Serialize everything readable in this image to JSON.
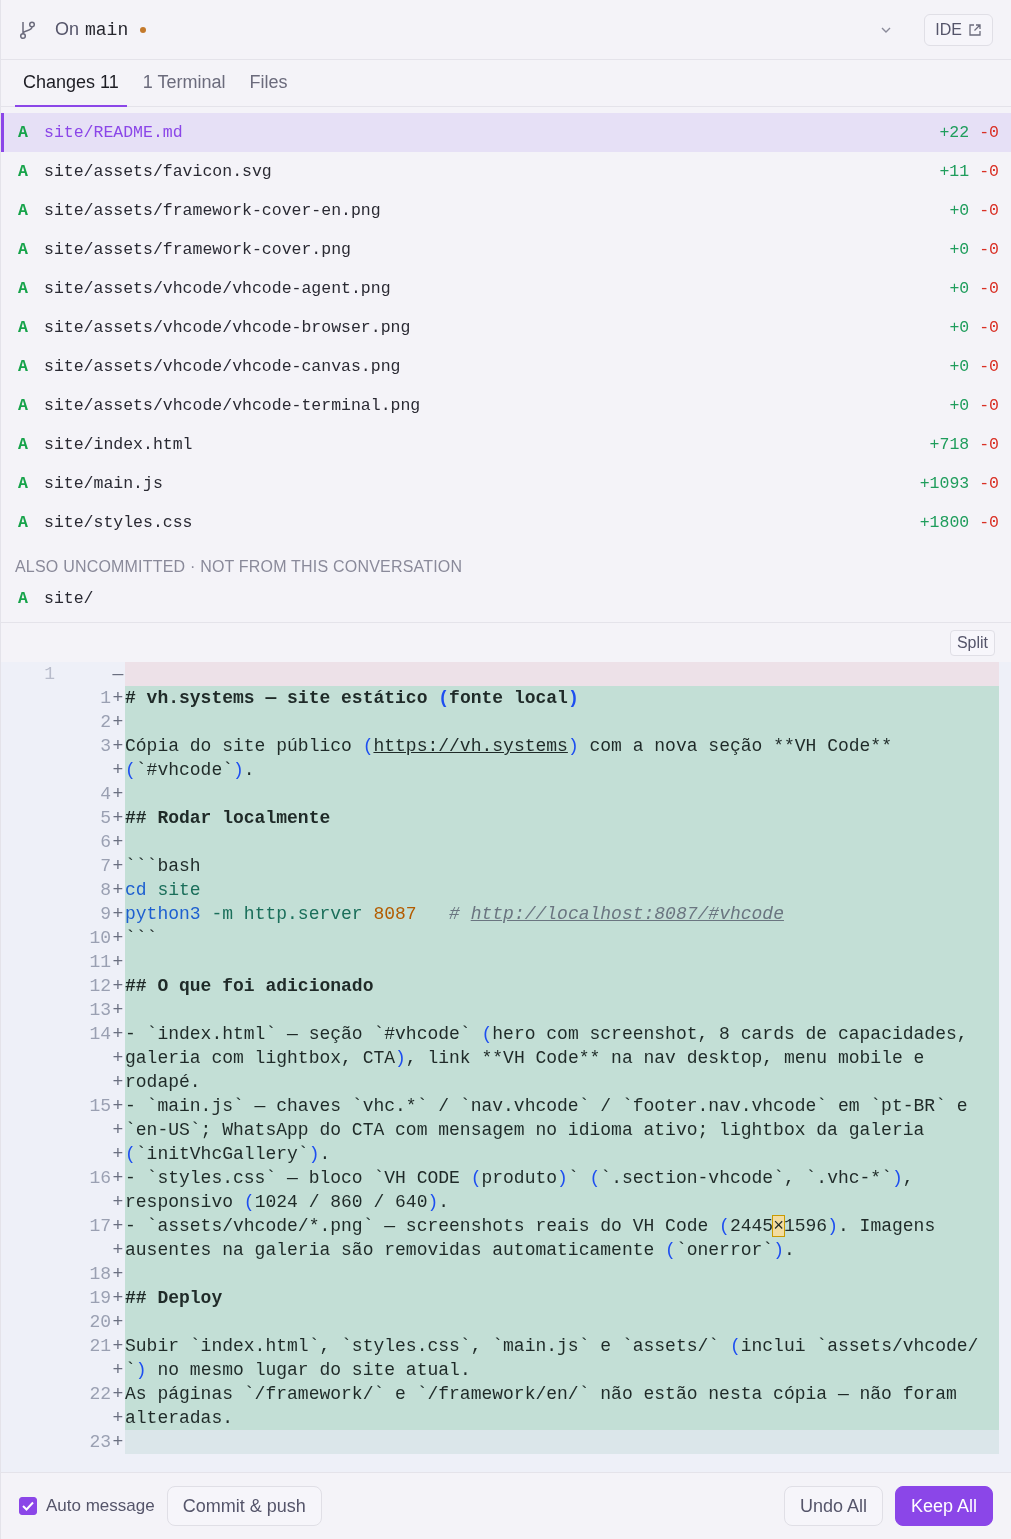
{
  "branch": {
    "prefix": "On",
    "name": "main",
    "dirty": true
  },
  "ide_button": "IDE",
  "tabs": [
    {
      "label": "Changes 11",
      "selected": true
    },
    {
      "label": "1 Terminal",
      "selected": false
    },
    {
      "label": "Files",
      "selected": false
    }
  ],
  "files": [
    {
      "status": "A",
      "path": "site/README.md",
      "added": "+22",
      "removed": "-0",
      "selected": true
    },
    {
      "status": "A",
      "path": "site/assets/favicon.svg",
      "added": "+11",
      "removed": "-0",
      "selected": false
    },
    {
      "status": "A",
      "path": "site/assets/framework-cover-en.png",
      "added": "+0",
      "removed": "-0",
      "selected": false
    },
    {
      "status": "A",
      "path": "site/assets/framework-cover.png",
      "added": "+0",
      "removed": "-0",
      "selected": false
    },
    {
      "status": "A",
      "path": "site/assets/vhcode/vhcode-agent.png",
      "added": "+0",
      "removed": "-0",
      "selected": false
    },
    {
      "status": "A",
      "path": "site/assets/vhcode/vhcode-browser.png",
      "added": "+0",
      "removed": "-0",
      "selected": false
    },
    {
      "status": "A",
      "path": "site/assets/vhcode/vhcode-canvas.png",
      "added": "+0",
      "removed": "-0",
      "selected": false
    },
    {
      "status": "A",
      "path": "site/assets/vhcode/vhcode-terminal.png",
      "added": "+0",
      "removed": "-0",
      "selected": false
    },
    {
      "status": "A",
      "path": "site/index.html",
      "added": "+718",
      "removed": "-0",
      "selected": false
    },
    {
      "status": "A",
      "path": "site/main.js",
      "added": "+1093",
      "removed": "-0",
      "selected": false
    },
    {
      "status": "A",
      "path": "site/styles.css",
      "added": "+1800",
      "removed": "-0",
      "selected": false
    }
  ],
  "other_section": {
    "title": "ALSO UNCOMMITTED · NOT FROM THIS CONVERSATION",
    "files": [
      {
        "status": "A",
        "path": "site/"
      }
    ]
  },
  "diff": {
    "view_button": "Split",
    "lines": [
      {
        "kind": "deleted",
        "old": "1",
        "marker": "—"
      },
      {
        "kind": "added",
        "new": "1",
        "marker": "+",
        "bold": true,
        "rows": [
          {
            "segments": [
              {
                "kind": "text",
                "text": "# vh.systems — site estático "
              },
              {
                "kind": "paren",
                "text": "("
              },
              {
                "kind": "text",
                "text": "fonte local"
              },
              {
                "kind": "paren",
                "text": ")"
              }
            ]
          }
        ]
      },
      {
        "kind": "added",
        "new": "2",
        "marker": "+"
      },
      {
        "kind": "added",
        "new": "3",
        "marker": "+",
        "rows": [
          {
            "segments": [
              {
                "kind": "text",
                "text": "Cópia do site público "
              },
              {
                "kind": "paren",
                "text": "("
              },
              {
                "kind": "url",
                "text": "https://vh.systems"
              },
              {
                "kind": "paren",
                "text": ")"
              },
              {
                "kind": "text",
                "text": " com a nova seção **VH Code**"
              }
            ]
          },
          {
            "segments": [
              {
                "kind": "paren",
                "text": "("
              },
              {
                "kind": "text",
                "text": "`#vhcode`"
              },
              {
                "kind": "paren",
                "text": ")"
              },
              {
                "kind": "text",
                "text": "."
              }
            ]
          }
        ]
      },
      {
        "kind": "added",
        "new": "4",
        "marker": "+"
      },
      {
        "kind": "added",
        "new": "5",
        "marker": "+",
        "bold": true,
        "rows": [
          {
            "segments": [
              {
                "kind": "text",
                "text": "## Rodar localmente"
              }
            ]
          }
        ]
      },
      {
        "kind": "added",
        "new": "6",
        "marker": "+"
      },
      {
        "kind": "added",
        "new": "7",
        "marker": "+",
        "rows": [
          {
            "segments": [
              {
                "kind": "text",
                "text": "```bash"
              }
            ]
          }
        ]
      },
      {
        "kind": "added",
        "new": "8",
        "marker": "+",
        "rows": [
          {
            "segments": [
              {
                "kind": "keyword",
                "text": "cd "
              },
              {
                "kind": "arg",
                "text": "site"
              }
            ]
          }
        ]
      },
      {
        "kind": "added",
        "new": "9",
        "marker": "+",
        "rows": [
          {
            "segments": [
              {
                "kind": "keyword",
                "text": "python3 "
              },
              {
                "kind": "arg",
                "text": "-m http.server "
              },
              {
                "kind": "number",
                "text": "8087"
              },
              {
                "kind": "comment",
                "text": "   # "
              },
              {
                "kind": "comment-url",
                "text": "http://localhost:8087/#vhcode"
              }
            ]
          }
        ]
      },
      {
        "kind": "added",
        "new": "10",
        "marker": "+",
        "rows": [
          {
            "segments": [
              {
                "kind": "text",
                "text": "```"
              }
            ]
          }
        ]
      },
      {
        "kind": "added",
        "new": "11",
        "marker": "+"
      },
      {
        "kind": "added",
        "new": "12",
        "marker": "+",
        "bold": true,
        "rows": [
          {
            "segments": [
              {
                "kind": "text",
                "text": "## O que foi adicionado"
              }
            ]
          }
        ]
      },
      {
        "kind": "added",
        "new": "13",
        "marker": "+"
      },
      {
        "kind": "added",
        "new": "14",
        "marker": "+",
        "rows": [
          {
            "segments": [
              {
                "kind": "text",
                "text": "- `index.html` — seção `#vhcode` "
              },
              {
                "kind": "paren",
                "text": "("
              },
              {
                "kind": "text",
                "text": "hero com screenshot, 8 cards de capacidades,"
              }
            ]
          },
          {
            "segments": [
              {
                "kind": "text",
                "text": "galeria com lightbox, CTA"
              },
              {
                "kind": "paren",
                "text": ")"
              },
              {
                "kind": "text",
                "text": ", link **VH Code** na nav desktop, menu mobile e"
              }
            ]
          },
          {
            "segments": [
              {
                "kind": "text",
                "text": "rodapé."
              }
            ]
          }
        ]
      },
      {
        "kind": "added",
        "new": "15",
        "marker": "+",
        "rows": [
          {
            "segments": [
              {
                "kind": "text",
                "text": "- `main.js` — chaves `vhc.*` / `nav.vhcode` / `footer.nav.vhcode` em `pt-BR` e"
              }
            ]
          },
          {
            "segments": [
              {
                "kind": "text",
                "text": "`en-US`; WhatsApp do CTA com mensagem no idioma ativo; lightbox da galeria"
              }
            ]
          },
          {
            "segments": [
              {
                "kind": "paren",
                "text": "("
              },
              {
                "kind": "text",
                "text": "`initVhcGallery`"
              },
              {
                "kind": "paren",
                "text": ")"
              },
              {
                "kind": "text",
                "text": "."
              }
            ]
          }
        ]
      },
      {
        "kind": "added",
        "new": "16",
        "marker": "+",
        "rows": [
          {
            "segments": [
              {
                "kind": "text",
                "text": "- `styles.css` — bloco `VH CODE "
              },
              {
                "kind": "paren",
                "text": "("
              },
              {
                "kind": "text",
                "text": "produto"
              },
              {
                "kind": "paren",
                "text": ")"
              },
              {
                "kind": "text",
                "text": "` "
              },
              {
                "kind": "paren",
                "text": "("
              },
              {
                "kind": "text",
                "text": "`.section-vhcode`, `.vhc-*`"
              },
              {
                "kind": "paren",
                "text": ")"
              },
              {
                "kind": "text",
                "text": ","
              }
            ]
          },
          {
            "segments": [
              {
                "kind": "text",
                "text": "responsivo "
              },
              {
                "kind": "paren",
                "text": "("
              },
              {
                "kind": "text",
                "text": "1024 / 860 / 640"
              },
              {
                "kind": "paren",
                "text": ")"
              },
              {
                "kind": "text",
                "text": "."
              }
            ]
          }
        ]
      },
      {
        "kind": "added",
        "new": "17",
        "marker": "+",
        "rows": [
          {
            "segments": [
              {
                "kind": "text",
                "text": "- `assets/vhcode/*.png` — screenshots reais do VH Code "
              },
              {
                "kind": "paren",
                "text": "("
              },
              {
                "kind": "text",
                "text": "2445"
              },
              {
                "kind": "match",
                "text": "×"
              },
              {
                "kind": "text",
                "text": "1596"
              },
              {
                "kind": "paren",
                "text": ")"
              },
              {
                "kind": "text",
                "text": ". Imagens"
              }
            ]
          },
          {
            "segments": [
              {
                "kind": "text",
                "text": "ausentes na galeria são removidas automaticamente "
              },
              {
                "kind": "paren",
                "text": "("
              },
              {
                "kind": "text",
                "text": "`onerror`"
              },
              {
                "kind": "paren",
                "text": ")"
              },
              {
                "kind": "text",
                "text": "."
              }
            ]
          }
        ]
      },
      {
        "kind": "added",
        "new": "18",
        "marker": "+"
      },
      {
        "kind": "added",
        "new": "19",
        "marker": "+",
        "bold": true,
        "rows": [
          {
            "segments": [
              {
                "kind": "text",
                "text": "## Deploy"
              }
            ]
          }
        ]
      },
      {
        "kind": "added",
        "new": "20",
        "marker": "+"
      },
      {
        "kind": "added",
        "new": "21",
        "marker": "+",
        "rows": [
          {
            "segments": [
              {
                "kind": "text",
                "text": "Subir `index.html`, `styles.css`, `main.js` e `assets/` "
              },
              {
                "kind": "paren",
                "text": "("
              },
              {
                "kind": "text",
                "text": "inclui `assets/vhcode/"
              }
            ]
          },
          {
            "segments": [
              {
                "kind": "text",
                "text": "`"
              },
              {
                "kind": "paren",
                "text": ")"
              },
              {
                "kind": "text",
                "text": " no mesmo lugar do site atual."
              }
            ]
          }
        ]
      },
      {
        "kind": "added",
        "new": "22",
        "marker": "+",
        "rows": [
          {
            "segments": [
              {
                "kind": "text",
                "text": "As páginas `/framework/` e `/framework/en/` não estão nesta cópia — não foram"
              }
            ]
          },
          {
            "segments": [
              {
                "kind": "text",
                "text": "alteradas."
              }
            ]
          }
        ]
      },
      {
        "kind": "added",
        "new": "23",
        "marker": "+",
        "current": true
      }
    ]
  },
  "footer": {
    "auto_message": {
      "label": "Auto message",
      "checked": true
    },
    "commit": "Commit & push",
    "undo": "Undo All",
    "keep": "Keep All"
  }
}
